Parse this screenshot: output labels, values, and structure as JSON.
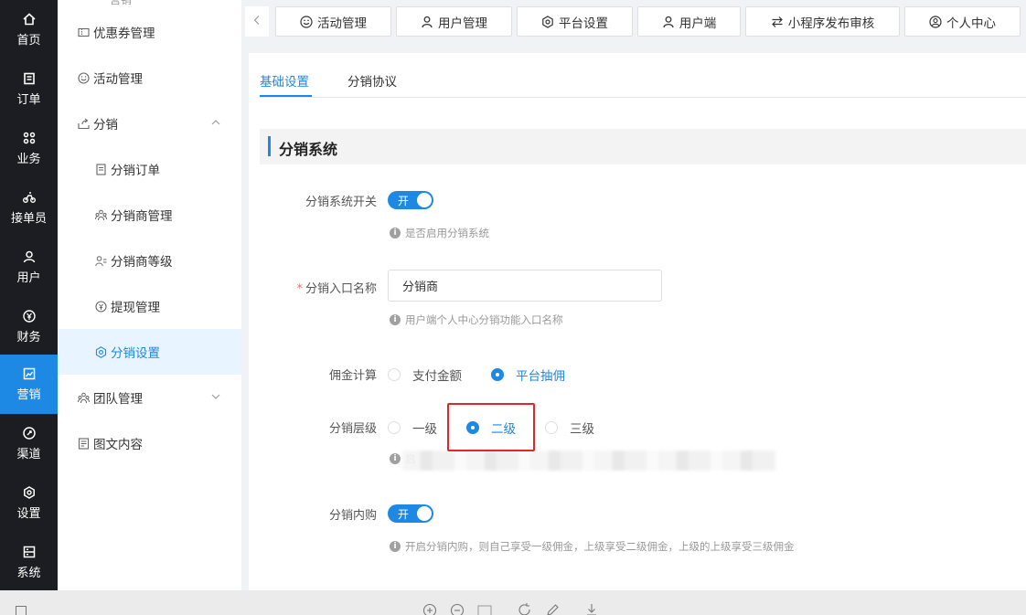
{
  "rail": {
    "items": [
      {
        "label": "首页",
        "icon": "home-icon"
      },
      {
        "label": "订单",
        "icon": "order-icon"
      },
      {
        "label": "业务",
        "icon": "business-icon"
      },
      {
        "label": "接单员",
        "icon": "rider-icon"
      },
      {
        "label": "用户",
        "icon": "user-icon"
      },
      {
        "label": "财务",
        "icon": "finance-icon"
      },
      {
        "label": "营销",
        "icon": "marketing-icon",
        "active": true
      },
      {
        "label": "渠道",
        "icon": "channel-icon"
      },
      {
        "label": "设置",
        "icon": "settings-icon"
      },
      {
        "label": "系统",
        "icon": "system-icon"
      }
    ]
  },
  "submenu": {
    "top_cut": "営销",
    "items": [
      {
        "label": "优惠券管理"
      },
      {
        "label": "活动管理"
      },
      {
        "label": "分销"
      },
      {
        "label": "分销订单"
      },
      {
        "label": "分销商管理"
      },
      {
        "label": "分销商等级"
      },
      {
        "label": "提现管理"
      },
      {
        "label": "分销设置",
        "active": true
      },
      {
        "label": "团队管理"
      },
      {
        "label": "图文内容"
      }
    ]
  },
  "tabs": [
    {
      "label": "活动管理"
    },
    {
      "label": "用户管理"
    },
    {
      "label": "平台设置"
    },
    {
      "label": "用户端"
    },
    {
      "label": "小程序发布审核"
    },
    {
      "label": "个人中心"
    }
  ],
  "page_tabs": [
    {
      "label": "基础设置",
      "active": true
    },
    {
      "label": "分销协议"
    }
  ],
  "section_title": "分销系统",
  "form": {
    "switch_label": "分销系统开关",
    "switch_state": "开",
    "switch_hint": "是否启用分销系统",
    "entry_required": "*",
    "entry_label": "分销入口名称",
    "entry_value": "分销商",
    "entry_hint": "用户端个人中心分销功能入口名称",
    "commission_label": "佣金计算",
    "commission_options": [
      "支付金额",
      "平台抽佣"
    ],
    "commission_selected": "平台抽佣",
    "level_label": "分销层级",
    "level_options": [
      "一级",
      "二级",
      "三级"
    ],
    "level_selected": "二级",
    "level_hint_cut": "启",
    "inner_label": "分销内购",
    "inner_state": "开",
    "inner_hint": "开启分销内购，则自己享受一级佣金，上级享受二级佣金，上级的上级享受三级佣金"
  },
  "colors": {
    "accent": "#1e88e5",
    "rail_bg": "#1b1d22",
    "highlight_box": "#e3262b"
  }
}
